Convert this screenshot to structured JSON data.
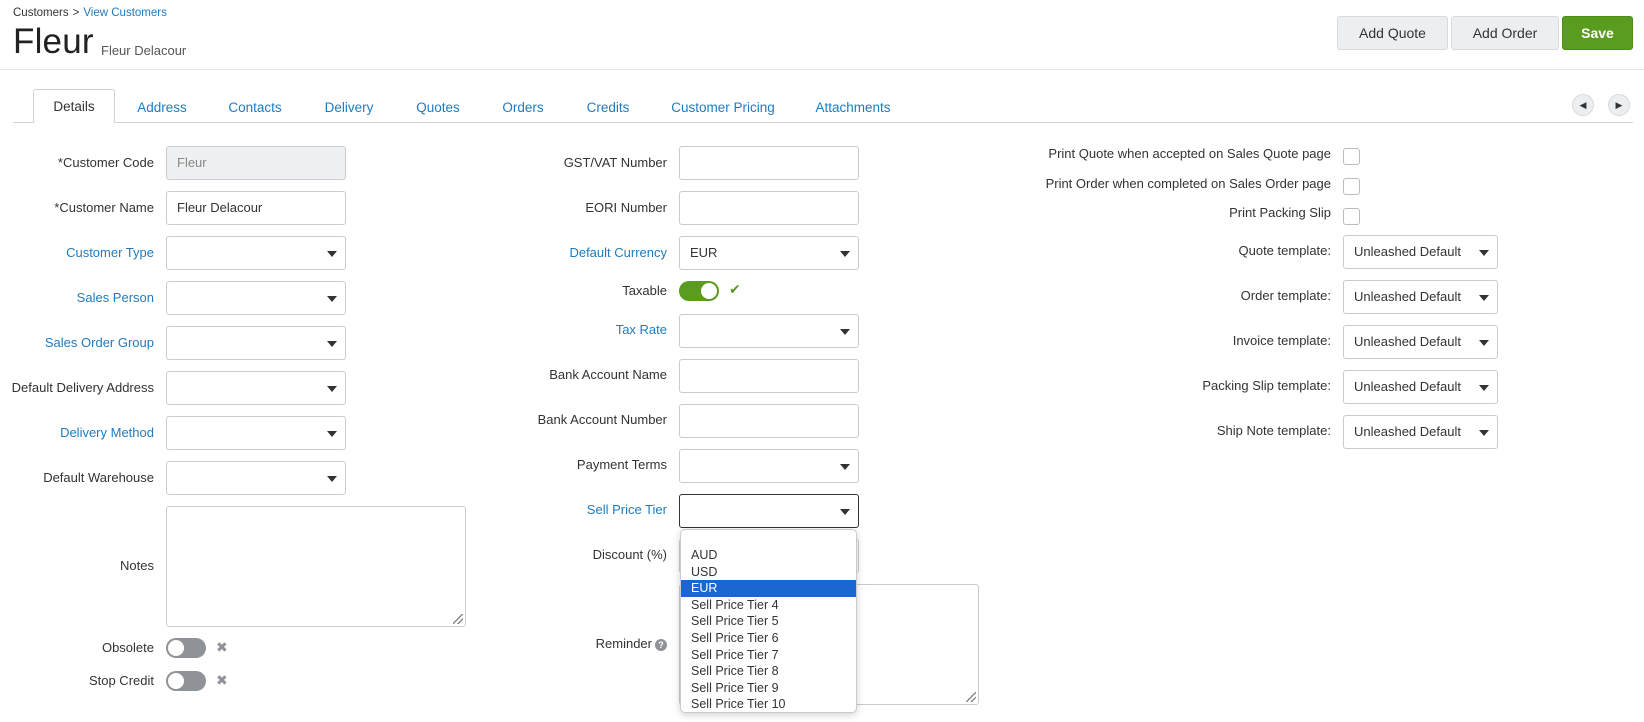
{
  "breadcrumb": {
    "root": "Customers",
    "separator": ">",
    "current": "View Customers"
  },
  "page": {
    "title": "Fleur",
    "subtitle": "Fleur Delacour"
  },
  "header_buttons": {
    "add_quote": "Add Quote",
    "add_order": "Add Order",
    "save": "Save"
  },
  "tabs": [
    "Details",
    "Address",
    "Contacts",
    "Delivery",
    "Quotes",
    "Orders",
    "Credits",
    "Customer Pricing",
    "Attachments"
  ],
  "active_tab": "Details",
  "left_form": {
    "customer_code": {
      "label": "*Customer Code",
      "value": "Fleur"
    },
    "customer_name": {
      "label": "*Customer Name",
      "value": "Fleur Delacour"
    },
    "customer_type": {
      "label": "Customer Type",
      "value": ""
    },
    "sales_person": {
      "label": "Sales Person",
      "value": ""
    },
    "sales_order_group": {
      "label": "Sales Order Group",
      "value": ""
    },
    "default_delivery_address": {
      "label": "Default Delivery Address",
      "value": ""
    },
    "delivery_method": {
      "label": "Delivery Method",
      "value": ""
    },
    "default_warehouse": {
      "label": "Default Warehouse",
      "value": ""
    },
    "notes": {
      "label": "Notes",
      "value": ""
    },
    "obsolete": {
      "label": "Obsolete",
      "on": false
    },
    "stop_credit": {
      "label": "Stop Credit",
      "on": false
    }
  },
  "middle_form": {
    "gst_vat_number": {
      "label": "GST/VAT Number",
      "value": ""
    },
    "eori_number": {
      "label": "EORI Number",
      "value": ""
    },
    "default_currency": {
      "label": "Default Currency",
      "value": "EUR"
    },
    "taxable": {
      "label": "Taxable",
      "on": true
    },
    "tax_rate": {
      "label": "Tax Rate",
      "value": ""
    },
    "bank_account_name": {
      "label": "Bank Account Name",
      "value": ""
    },
    "bank_account_number": {
      "label": "Bank Account Number",
      "value": ""
    },
    "payment_terms": {
      "label": "Payment Terms",
      "value": ""
    },
    "sell_price_tier": {
      "label": "Sell Price Tier",
      "value": ""
    },
    "discount": {
      "label": "Discount (%)"
    },
    "reminder": {
      "label": "Reminder"
    }
  },
  "dropdown": {
    "options": [
      "AUD",
      "USD",
      "EUR",
      "Sell Price Tier 4",
      "Sell Price Tier 5",
      "Sell Price Tier 6",
      "Sell Price Tier 7",
      "Sell Price Tier 8",
      "Sell Price Tier 9",
      "Sell Price Tier 10"
    ],
    "selected": "EUR"
  },
  "right_form": {
    "print_quote": {
      "label": "Print Quote when accepted on Sales Quote page",
      "checked": false
    },
    "print_order": {
      "label": "Print Order when completed on Sales Order page",
      "checked": false
    },
    "print_packing_slip": {
      "label": "Print Packing Slip",
      "checked": false
    },
    "quote_template": {
      "label": "Quote template:",
      "value": "Unleashed Default"
    },
    "order_template": {
      "label": "Order template:",
      "value": "Unleashed Default"
    },
    "invoice_template": {
      "label": "Invoice template:",
      "value": "Unleashed Default"
    },
    "packing_slip_template": {
      "label": "Packing Slip template:",
      "value": "Unleashed Default"
    },
    "ship_note_template": {
      "label": "Ship Note template:",
      "value": "Unleashed Default"
    }
  },
  "colors": {
    "accent": "#1f7bbf",
    "save_green": "#5a9c1f",
    "selected_blue": "#1a67d2"
  },
  "icons": {
    "tab_prev": "caret-left-icon",
    "tab_next": "caret-right-icon",
    "toggle_off": "x-icon",
    "toggle_on": "check-icon",
    "reminder_help": "question-circle-icon"
  }
}
